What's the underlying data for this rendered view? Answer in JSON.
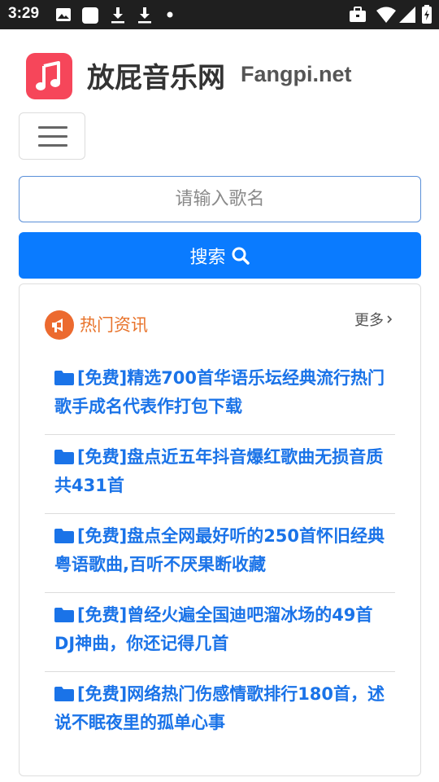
{
  "status_bar": {
    "time": "3:29",
    "left_icons": [
      "image-icon",
      "app-square-icon",
      "download-icon",
      "download-icon",
      "dot-icon"
    ],
    "right_icons": [
      "briefcase-icon",
      "wifi-icon",
      "signal-icon",
      "battery-icon"
    ]
  },
  "header": {
    "site_title": "放屁音乐网",
    "site_domain": "Fangpi.net",
    "logo_icon": "music-note-icon",
    "logo_color": "#f6465a"
  },
  "search": {
    "placeholder": "请输入歌名",
    "value": "",
    "button_label": "搜索",
    "button_color": "#0a7bff"
  },
  "news": {
    "title": "热门资讯",
    "more_label": "更多",
    "items": [
      {
        "text": "[免费]精选700首华语乐坛经典流行热门歌手成名代表作打包下载"
      },
      {
        "text": "[免费]盘点近五年抖音爆红歌曲无损音质共431首"
      },
      {
        "text": "[免费]盘点全网最好听的250首怀旧经典粤语歌曲,百听不厌果断收藏"
      },
      {
        "text": "[免费]曾经火遍全国迪吧溜冰场的49首DJ神曲，你还记得几首"
      },
      {
        "text": "[免费]网络热门伤感情歌排行180首，述说不眠夜里的孤单心事"
      }
    ]
  }
}
